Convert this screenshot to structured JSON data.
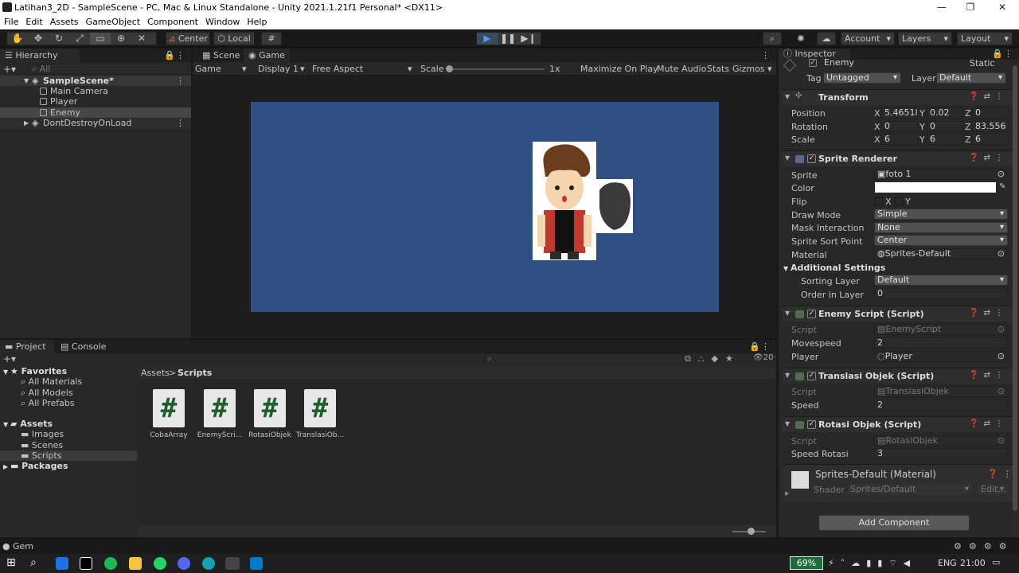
{
  "window": {
    "title": "Latihan3_2D - SampleScene - PC, Mac & Linux Standalone - Unity 2021.1.21f1 Personal* <DX11>"
  },
  "menu": [
    "File",
    "Edit",
    "Assets",
    "GameObject",
    "Component",
    "Window",
    "Help"
  ],
  "toolbar": {
    "pivot_label": "Center",
    "space_label": "Local",
    "account_label": "Account",
    "layers_label": "Layers",
    "layout_label": "Layout"
  },
  "hierarchy": {
    "tab": "Hierarchy",
    "search_placeholder": "All",
    "scene": "SampleScene*",
    "items": [
      "Main Camera",
      "Player",
      "Enemy"
    ],
    "dontdestroy": "DontDestroyOnLoad"
  },
  "gameview": {
    "tabs": [
      "Scene",
      "Game"
    ],
    "display_mode": "Game",
    "display": "Display 1",
    "aspect": "Free Aspect",
    "scale_label": "Scale",
    "scale_value": "1x",
    "toggles": [
      "Maximize On Play",
      "Mute Audio",
      "Stats",
      "Gizmos"
    ],
    "background_color": "#2f4f83"
  },
  "project": {
    "tabs": [
      "Project",
      "Console"
    ],
    "favorites_label": "Favorites",
    "favorites": [
      "All Materials",
      "All Models",
      "All Prefabs"
    ],
    "assets_label": "Assets",
    "folders": [
      "Images",
      "Scenes",
      "Scripts"
    ],
    "packages_label": "Packages",
    "breadcrumb_root": "Assets",
    "breadcrumb_sep": ">",
    "breadcrumb_current": "Scripts",
    "hidden_count": "20",
    "files": [
      "CobaArray",
      "EnemyScri...",
      "RotasiObjek",
      "TranslasiOb..."
    ]
  },
  "inspector": {
    "tab": "Inspector",
    "object_name": "Enemy",
    "static_label": "Static",
    "tag_label": "Tag",
    "tag_value": "Untagged",
    "layer_label": "Layer",
    "layer_value": "Default",
    "transform": {
      "title": "Transform",
      "position_label": "Position",
      "rotation_label": "Rotation",
      "scale_label": "Scale",
      "axis_x": "X",
      "axis_y": "Y",
      "axis_z": "Z",
      "position": [
        "5.46518",
        "0.02",
        "0"
      ],
      "rotation": [
        "0",
        "0",
        "83.556"
      ],
      "scale": [
        "6",
        "6",
        "6"
      ]
    },
    "sprite_renderer": {
      "title": "Sprite Renderer",
      "sprite_label": "Sprite",
      "sprite_value": "foto 1",
      "color_label": "Color",
      "color_value": "#ffffff",
      "flip_label": "Flip",
      "flip_x": "X",
      "flip_y": "Y",
      "draw_mode_label": "Draw Mode",
      "draw_mode_value": "Simple",
      "mask_label": "Mask Interaction",
      "mask_value": "None",
      "sort_point_label": "Sprite Sort Point",
      "sort_point_value": "Center",
      "material_label": "Material",
      "material_value": "Sprites-Default",
      "additional_label": "Additional Settings",
      "sorting_layer_label": "Sorting Layer",
      "sorting_layer_value": "Default",
      "order_label": "Order in Layer",
      "order_value": "0"
    },
    "enemy_script": {
      "title": "Enemy Script (Script)",
      "script_label": "Script",
      "script_value": "EnemyScript",
      "movespeed_label": "Movespeed",
      "movespeed_value": "2",
      "player_label": "Player",
      "player_value": "Player"
    },
    "translasi": {
      "title": "Translasi Objek (Script)",
      "script_label": "Script",
      "script_value": "TranslasiObjek",
      "speed_label": "Speed",
      "speed_value": "2"
    },
    "rotasi": {
      "title": "Rotasi Objek (Script)",
      "script_label": "Script",
      "script_value": "RotasiObjek",
      "speed_label": "Speed Rotasi",
      "speed_value": "3"
    },
    "material": {
      "title": "Sprites-Default (Material)",
      "shader_label": "Shader",
      "shader_value": "Sprites/Default",
      "edit_label": "Edit..."
    },
    "add_component": "Add Component"
  },
  "statusbar": {
    "text": "Gem"
  },
  "taskbar": {
    "battery": "69%",
    "lang": "ENG",
    "time": "21:00"
  }
}
